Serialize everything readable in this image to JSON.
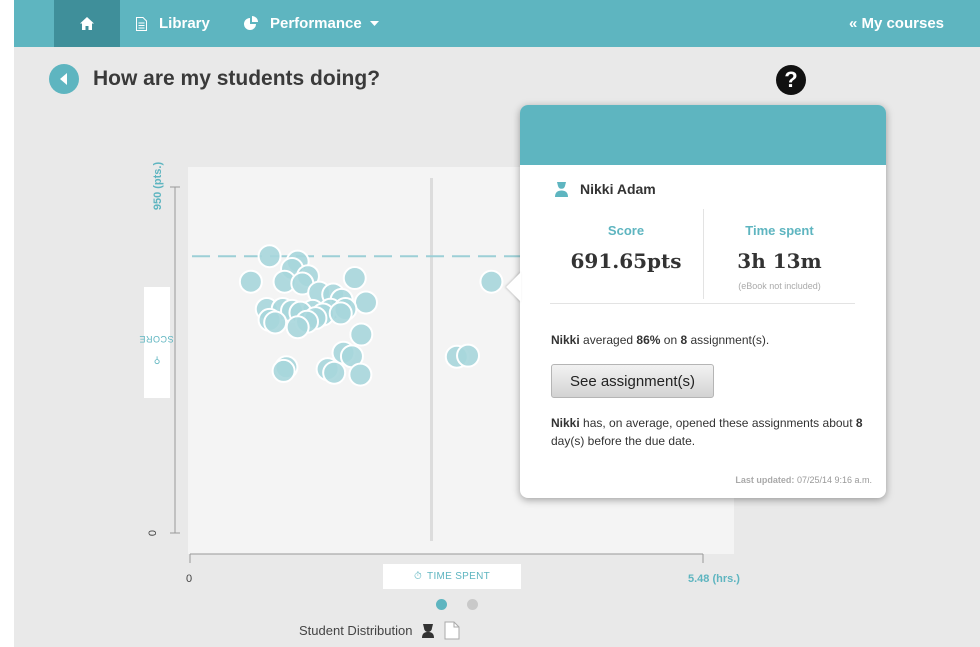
{
  "nav": {
    "library_label": "Library",
    "performance_label": "Performance",
    "my_courses_label": "« My courses"
  },
  "page": {
    "title": "How are my students doing?"
  },
  "chart_data": {
    "type": "scatter",
    "ylabel": "SCORE",
    "y_max_label": "950 (pts.)",
    "y_min_label": "0",
    "xlabel": "TIME SPENT",
    "x_min_label": "0",
    "x_max_label": "5.48 (hrs.)",
    "xlim": [
      0,
      5.48
    ],
    "ylim": [
      0,
      950
    ],
    "average_score_line": 760,
    "time_divider": 2.58,
    "points": [
      [
        0.85,
        760
      ],
      [
        1.15,
        745
      ],
      [
        0.65,
        690
      ],
      [
        1.09,
        725
      ],
      [
        1.26,
        705
      ],
      [
        1.76,
        700
      ],
      [
        1.01,
        690
      ],
      [
        1.2,
        685
      ],
      [
        1.38,
        660
      ],
      [
        1.53,
        655
      ],
      [
        1.62,
        640
      ],
      [
        1.88,
        633
      ],
      [
        0.82,
        615
      ],
      [
        0.99,
        615
      ],
      [
        1.31,
        610
      ],
      [
        1.5,
        613
      ],
      [
        1.66,
        615
      ],
      [
        1.09,
        610
      ],
      [
        1.18,
        605
      ],
      [
        1.42,
        600
      ],
      [
        1.34,
        590
      ],
      [
        0.85,
        585
      ],
      [
        1.25,
        580
      ],
      [
        0.91,
        578
      ],
      [
        1.61,
        603
      ],
      [
        1.15,
        565
      ],
      [
        1.83,
        545
      ],
      [
        1.64,
        495
      ],
      [
        1.73,
        485
      ],
      [
        1.03,
        455
      ],
      [
        1.0,
        445
      ],
      [
        1.47,
        450
      ],
      [
        1.54,
        440
      ],
      [
        1.82,
        435
      ],
      [
        2.85,
        484
      ],
      [
        2.97,
        487
      ],
      [
        3.22,
        690
      ]
    ]
  },
  "popup": {
    "student_name": "Nikki Adam",
    "score_label": "Score",
    "score_value": "691.65pts",
    "time_label": "Time spent",
    "time_value": "3h 13m",
    "time_note": "(eBook not included)",
    "avg_name": "Nikki",
    "avg_mid": " averaged ",
    "avg_percent": "86%",
    "avg_on": " on ",
    "avg_count": "8",
    "avg_end": " assignment(s).",
    "button_label": "See assignment(s)",
    "opened_name": "Nikki",
    "opened_mid": " has, on average, opened these assignments about ",
    "opened_days": "8",
    "opened_end": " day(s) before the due date.",
    "updated_label": "Last updated:",
    "updated_value": " 07/25/14 9:16 a.m."
  },
  "footer": {
    "distribution_label": "Student Distribution"
  },
  "colors": {
    "accent": "#5eb5c0",
    "nav_active": "#3f8f9a",
    "point_fill": "#a7d6dc"
  }
}
